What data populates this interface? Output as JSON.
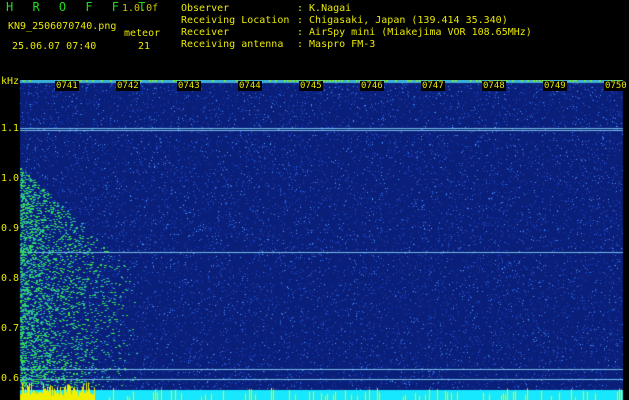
{
  "header": {
    "brand": "H R O F F T",
    "version": "1.0.0f",
    "filename": "KN9_2506070740.png",
    "timestamp": "25.06.07 07:40",
    "meteor_label": "meteor",
    "meteor_count": "21",
    "info": [
      {
        "key": "Observer",
        "value": ": K.Nagai"
      },
      {
        "key": "Receiving Location",
        "value": ": Chigasaki, Japan (139.414 35.340)"
      },
      {
        "key": "Receiver",
        "value": ": AirSpy mini (Miakejima VOR 108.65MHz)"
      },
      {
        "key": "Receiving antenna",
        "value": ": Maspro FM-3"
      }
    ]
  },
  "chart_data": {
    "type": "heatmap",
    "ylabel": "kHz",
    "yticks": [
      1.1,
      1.0,
      0.9,
      0.8,
      0.7,
      0.6
    ],
    "ylim": [
      0.58,
      1.18
    ],
    "time_labels": [
      "0741",
      "0742",
      "0743",
      "0744",
      "0745",
      "0746",
      "0747",
      "0748",
      "0749",
      "0750"
    ],
    "horizontal_lines_khz": [
      1.103,
      1.098,
      0.855,
      0.62,
      0.6
    ],
    "colors": {
      "background": "#0a1f7a",
      "noise": "#1c4fd8",
      "line": "#8fe3ff",
      "meteor": "#35e04a",
      "bottom_bar": "#18e8ff",
      "bottom_yellow": "#f0f000"
    }
  }
}
